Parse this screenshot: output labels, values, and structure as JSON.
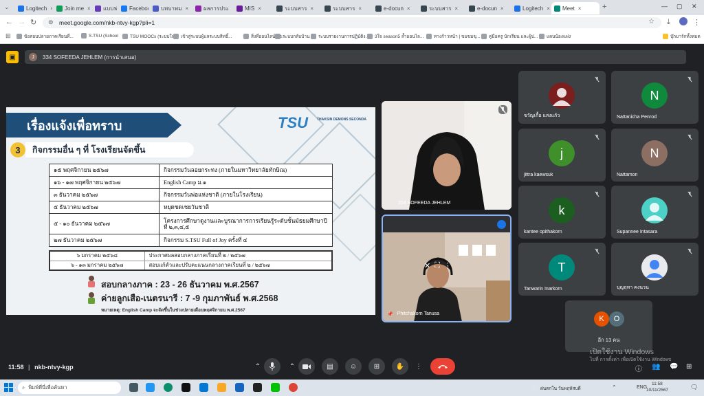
{
  "browser": {
    "tabs": [
      {
        "label": "Logitech",
        "color": "#1a73e8"
      },
      {
        "label": "Join me",
        "color": "#0f9d58"
      },
      {
        "label": "แบบฟอร์",
        "color": "#673ab7"
      },
      {
        "label": "Faceboo",
        "color": "#1877f2"
      },
      {
        "label": "บทบาทม",
        "color": "#4b5cc4"
      },
      {
        "label": "ผลการประ",
        "color": "#8e24aa"
      },
      {
        "label": "MIS",
        "color": "#6a1b9a"
      },
      {
        "label": "ระบบสาร",
        "color": "#37474f"
      },
      {
        "label": "ระบบสาร",
        "color": "#37474f"
      },
      {
        "label": "e-docun",
        "color": "#37474f"
      },
      {
        "label": "ระบบสาร",
        "color": "#37474f"
      },
      {
        "label": "e-docun",
        "color": "#37474f"
      },
      {
        "label": "Logitech",
        "color": "#1a73e8"
      },
      {
        "label": "Meet",
        "color": "#00897b"
      }
    ],
    "url": "meet.google.com/nkb-ntvy-kgp?pli=1",
    "bookmarks": [
      "ข้อสอบปลายภาคเรียนที่...",
      "S.TSU (School",
      "TSU MOOCs (ระบบใหม่)",
      "เข้าสู่ระบบผู้แลระบบสิทธิ์...",
      "สิ่งที่ออนไลน์ สธ.",
      "ระบบกลับบ้าน",
      "ระบบรายงานการปฏิบัติง...",
      "3ใจ season5 ล้ำออนไล...",
      "ทางก้าวหน้า | ขมขมขุ...",
      "คู่มือครู นักเรียน และผู้ป...",
      "แผนน้องแฝง"
    ],
    "all_bookmarks": "บุ๊กมาร์กทั้งหมด"
  },
  "meet": {
    "presenter_label": "334 SOFEEDA JEHLEM (การนำเสนอ)",
    "presenter_initial": "J",
    "tiles": [
      {
        "name": "ขวัญเกื้อ แสงแก้ว",
        "initial": "",
        "color": "#7b1e1e",
        "photo": true
      },
      {
        "name": "Nattanicha Penrod",
        "initial": "N",
        "color": "#0f8a3c"
      },
      {
        "name": "jittra kaewsuk",
        "initial": "j",
        "color": "#3f8f2b"
      },
      {
        "name": "Nattamon",
        "initial": "N",
        "color": "#8d6e63"
      },
      {
        "name": "kantee opithakorn",
        "initial": "k",
        "color": "#1b5e20"
      },
      {
        "name": "Supannee Intasara",
        "initial": "",
        "color": "#4dd0c5",
        "photo": true
      },
      {
        "name": "Tanwarin Inarkorn",
        "initial": "T",
        "color": "#00897b"
      },
      {
        "name": "บุญฤทา คงนวน",
        "initial": "",
        "color": "#e8eaed",
        "photo": true
      }
    ],
    "video_tiles": [
      {
        "name": "334 SOFEEDA JEHLEM"
      },
      {
        "name": "Phitchakorn Tanusa"
      }
    ],
    "others": {
      "label": "อีก 13 คน",
      "initials": [
        "K",
        "O"
      ]
    },
    "meeting_code": "nkb-ntvy-kgp",
    "time": "11:58"
  },
  "slide": {
    "title": "เรื่องแจ้งเพื่อทราบ",
    "logo": "TSU",
    "logo_sub": "THAKSIN DEMONS SECONDA",
    "section_num": "3",
    "section_title": "กิจกรรมอื่น ๆ ที่ โรงเรียนจัดขึ้น",
    "activities": [
      {
        "date": "๑๕ พฤศจิกายน ๒๕๖๗",
        "event": "กิจกรรมวันลอยกระทง (ภายในมหาวิทยาลัยทักษิณ)"
      },
      {
        "date": "๑๖ - ๑๗ พฤศจิกายน ๒๕๖๗",
        "event": "English Camp ม.๑"
      },
      {
        "date": "๓ ธันวาคม ๒๕๖๗",
        "event": "กิจกรรมวันพ่อแห่งชาติ (ภายในโรงเรียน)"
      },
      {
        "date": "๕ ธันวาคม ๒๕๖๗",
        "event": "หยุดชดเชยวันชาติ"
      },
      {
        "date": "๕ - ๑๐ ธันวาคม ๒๕๖๗",
        "event": "โครงการศึกษาดูงานและบูรณาการการเรียนรู้ระดับชั้นมัธยมศึกษาปีที่ ๒,๓,๔,๕"
      },
      {
        "date": "๒๗ ธันวาคม ๒๕๖๗",
        "event": "กิจกรรม S.TSU Full of Joy ครั้งที่ ๔"
      }
    ],
    "exams": [
      {
        "date": "๖ มกราคม ๒๕๖๘",
        "event": "ประกาศผลสอบกลางภาคเรียนที่ ๒ / ๒๕๖๗"
      },
      {
        "date": "๖ - ๑๓ มกราคม ๒๕๖๗",
        "event": "สอบแก้ตัวและปรับคะแนนกลางภาคเรียนที่ ๒ / ๒๕๖๗"
      }
    ],
    "midterm": "สอบกลางภาค : 23 - 26 ธันวาคม พ.ศ.2567",
    "scout": "ค่ายลูกเสือ-เนตรนารี : 7 -9 กุมภาพันธ์ พ.ศ.2568",
    "note": "หมายเหตุ: English Camp จะจัดขึ้นในช่วงปลายเดือนพฤศจิกายน พ.ศ.2567"
  },
  "windows": {
    "watermark_title": "เปิดใช้งาน Windows",
    "watermark_sub": "ไปที่ การตั้งค่า เพื่อเปิดใช้งาน Windows",
    "search_placeholder": "พิมพ์ที่นี่เพื่อค้นหา",
    "weather": "ฝนตกใน วันพฤหัสบดี",
    "lang": "ENG",
    "clock_time": "11:58",
    "clock_date": "10/11/2567"
  }
}
